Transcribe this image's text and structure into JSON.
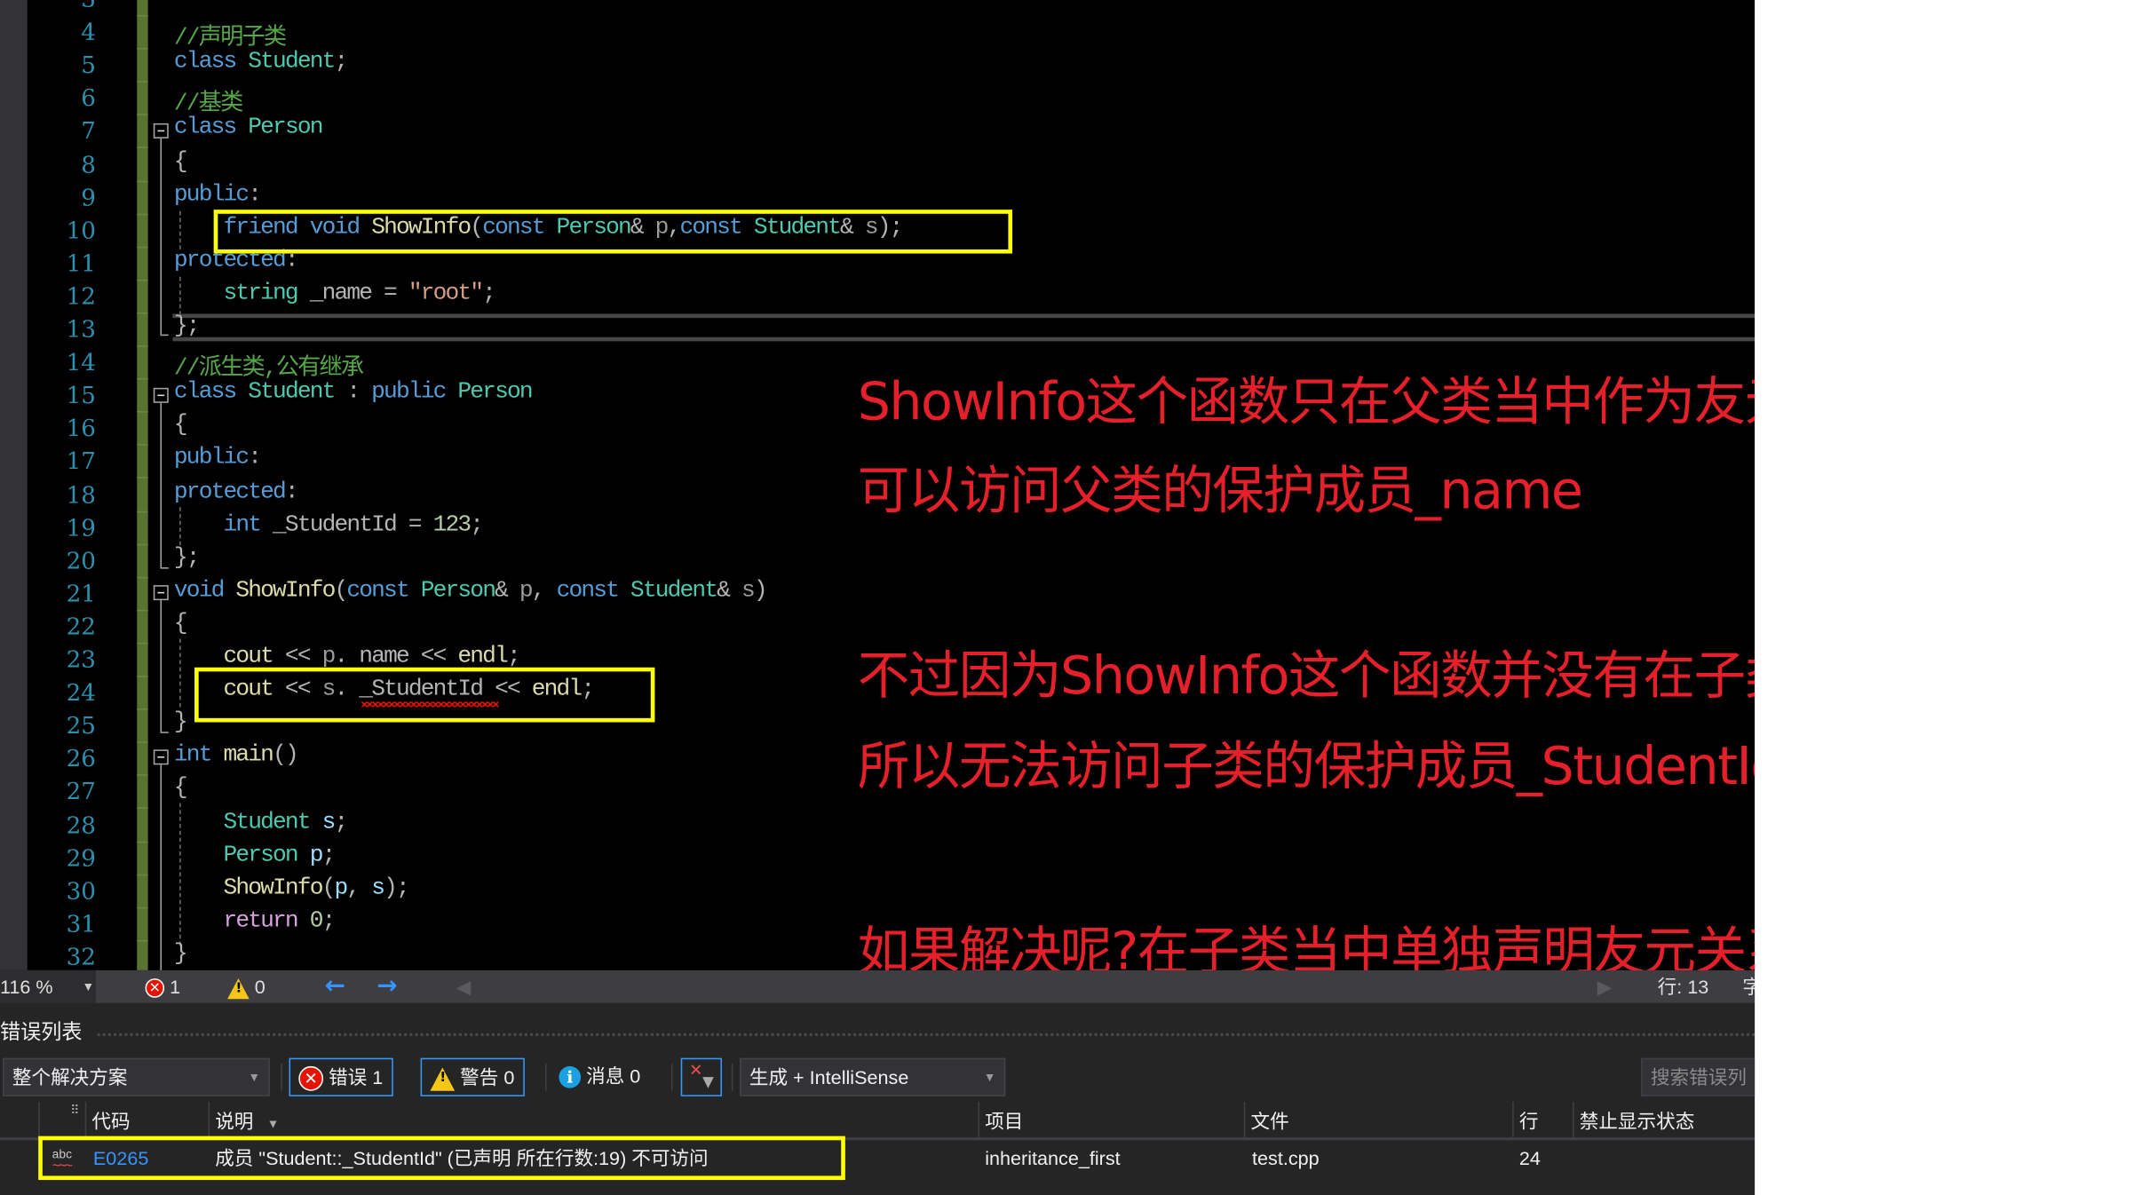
{
  "editor": {
    "lines": [
      {
        "n": "3",
        "tokens": []
      },
      {
        "n": "4",
        "tokens": [
          [
            "cm",
            "//声明子类"
          ]
        ]
      },
      {
        "n": "5",
        "tokens": [
          [
            "kw",
            "class"
          ],
          [
            "pu",
            " "
          ],
          [
            "ty",
            "Student"
          ],
          [
            "pu",
            ";"
          ]
        ]
      },
      {
        "n": "6",
        "tokens": [
          [
            "cm",
            "//基类"
          ]
        ]
      },
      {
        "n": "7",
        "tokens": [
          [
            "kw",
            "class"
          ],
          [
            "pu",
            " "
          ],
          [
            "ty",
            "Person"
          ]
        ]
      },
      {
        "n": "8",
        "tokens": [
          [
            "pu",
            "{"
          ]
        ]
      },
      {
        "n": "9",
        "tokens": [
          [
            "kw",
            "public"
          ],
          [
            "pu",
            ":"
          ]
        ]
      },
      {
        "n": "10",
        "tokens": [
          [
            "pu",
            "    "
          ],
          [
            "kw",
            "friend"
          ],
          [
            "pu",
            " "
          ],
          [
            "kw",
            "void"
          ],
          [
            "pu",
            " "
          ],
          [
            "fn",
            "ShowInfo"
          ],
          [
            "pu",
            "("
          ],
          [
            "kw",
            "const"
          ],
          [
            "pu",
            " "
          ],
          [
            "ty",
            "Person"
          ],
          [
            "pu",
            "& "
          ],
          [
            "pm",
            "p"
          ],
          [
            "pu",
            ","
          ],
          [
            "kw",
            "const"
          ],
          [
            "pu",
            " "
          ],
          [
            "ty",
            "Student"
          ],
          [
            "pu",
            "& "
          ],
          [
            "pm",
            "s"
          ],
          [
            "pu",
            ");"
          ]
        ]
      },
      {
        "n": "11",
        "tokens": [
          [
            "kw",
            "protected"
          ],
          [
            "pu",
            ":"
          ]
        ]
      },
      {
        "n": "12",
        "tokens": [
          [
            "pu",
            "    "
          ],
          [
            "ty",
            "string"
          ],
          [
            "pu",
            " "
          ],
          [
            "pu",
            "_name = "
          ],
          [
            "st",
            "\"root\""
          ],
          [
            "pu",
            ";"
          ]
        ]
      },
      {
        "n": "13",
        "tokens": [
          [
            "pu",
            "};"
          ]
        ]
      },
      {
        "n": "14",
        "tokens": [
          [
            "cm",
            "//派生类,公有继承"
          ]
        ]
      },
      {
        "n": "15",
        "tokens": [
          [
            "kw",
            "class"
          ],
          [
            "pu",
            " "
          ],
          [
            "ty",
            "Student"
          ],
          [
            "pu",
            " : "
          ],
          [
            "kw",
            "public"
          ],
          [
            "pu",
            " "
          ],
          [
            "ty",
            "Person"
          ]
        ]
      },
      {
        "n": "16",
        "tokens": [
          [
            "pu",
            "{"
          ]
        ]
      },
      {
        "n": "17",
        "tokens": [
          [
            "kw",
            "public"
          ],
          [
            "pu",
            ":"
          ]
        ]
      },
      {
        "n": "18",
        "tokens": [
          [
            "kw",
            "protected"
          ],
          [
            "pu",
            ":"
          ]
        ]
      },
      {
        "n": "19",
        "tokens": [
          [
            "pu",
            "    "
          ],
          [
            "kw",
            "int"
          ],
          [
            "pu",
            " _StudentId = "
          ],
          [
            "nu",
            "123"
          ],
          [
            "pu",
            ";"
          ]
        ]
      },
      {
        "n": "20",
        "tokens": [
          [
            "pu",
            "};"
          ]
        ]
      },
      {
        "n": "21",
        "tokens": [
          [
            "kw",
            "void"
          ],
          [
            "pu",
            " "
          ],
          [
            "fn",
            "ShowInfo"
          ],
          [
            "pu",
            "("
          ],
          [
            "kw",
            "const"
          ],
          [
            "pu",
            " "
          ],
          [
            "ty",
            "Person"
          ],
          [
            "pu",
            "& "
          ],
          [
            "pm",
            "p"
          ],
          [
            "pu",
            ", "
          ],
          [
            "kw",
            "const"
          ],
          [
            "pu",
            " "
          ],
          [
            "ty",
            "Student"
          ],
          [
            "pu",
            "& "
          ],
          [
            "pm",
            "s"
          ],
          [
            "pu",
            ")"
          ]
        ]
      },
      {
        "n": "22",
        "tokens": [
          [
            "pu",
            "{"
          ]
        ]
      },
      {
        "n": "23",
        "tokens": [
          [
            "pu",
            "    "
          ],
          [
            "fn",
            "cout"
          ],
          [
            "pu",
            " << "
          ],
          [
            "pm",
            "p"
          ],
          [
            "pu",
            ". "
          ],
          [
            "pu",
            "name << "
          ],
          [
            "fn",
            "endl"
          ],
          [
            "pu",
            ";"
          ]
        ]
      },
      {
        "n": "24",
        "tokens": [
          [
            "pu",
            "    "
          ],
          [
            "fn",
            "cout"
          ],
          [
            "pu",
            " << "
          ],
          [
            "pm",
            "s"
          ],
          [
            "pu",
            ". "
          ],
          [
            "pu",
            "_StudentId"
          ],
          [
            "pu",
            " << "
          ],
          [
            "fn",
            "endl"
          ],
          [
            "pu",
            ";"
          ]
        ]
      },
      {
        "n": "25",
        "tokens": [
          [
            "pu",
            "}"
          ]
        ]
      },
      {
        "n": "26",
        "tokens": [
          [
            "kw",
            "int"
          ],
          [
            "pu",
            " "
          ],
          [
            "fn",
            "main"
          ],
          [
            "pu",
            "()"
          ]
        ]
      },
      {
        "n": "27",
        "tokens": [
          [
            "pu",
            "{"
          ]
        ]
      },
      {
        "n": "28",
        "tokens": [
          [
            "pu",
            "    "
          ],
          [
            "ty",
            "Student"
          ],
          [
            "pu",
            " "
          ],
          [
            "lv",
            "s"
          ],
          [
            "pu",
            ";"
          ]
        ]
      },
      {
        "n": "29",
        "tokens": [
          [
            "pu",
            "    "
          ],
          [
            "ty",
            "Person"
          ],
          [
            "pu",
            " "
          ],
          [
            "lv",
            "p"
          ],
          [
            "pu",
            ";"
          ]
        ]
      },
      {
        "n": "30",
        "tokens": [
          [
            "pu",
            "    "
          ],
          [
            "fn",
            "ShowInfo"
          ],
          [
            "pu",
            "("
          ],
          [
            "lv",
            "p"
          ],
          [
            "pu",
            ", "
          ],
          [
            "lv",
            "s"
          ],
          [
            "pu",
            ");"
          ]
        ]
      },
      {
        "n": "31",
        "tokens": [
          [
            "pu",
            "    "
          ],
          [
            "rt",
            "return"
          ],
          [
            "pu",
            " "
          ],
          [
            "nu",
            "0"
          ],
          [
            "pu",
            ";"
          ]
        ]
      },
      {
        "n": "32",
        "tokens": [
          [
            "pu",
            "}"
          ]
        ]
      }
    ],
    "current_line": "13",
    "error_line": "24",
    "error_token": "_StudentId"
  },
  "annotations": [
    "ShowInfo这个函数只在父类当中作为友元",
    "可以访问父类的保护成员_name",
    "不过因为ShowInfo这个函数并没有在子类中作为友元",
    "所以无法访问子类的保护成员_StudentId",
    "如果解决呢?在子类当中单独声明友元关系即可"
  ],
  "statusbar": {
    "zoom": "116 %",
    "errors": "1",
    "warnings": "0",
    "back_icon": "←",
    "forward_icon": "→",
    "line_label": "行: 13",
    "col_label_partial": "字"
  },
  "error_list": {
    "title": "错误列表",
    "scope": "整个解决方案",
    "filter_errors": "错误 1",
    "filter_warnings": "警告 0",
    "filter_messages": "消息 0",
    "source": "生成 + IntelliSense",
    "search_placeholder": "搜索错误列",
    "columns": [
      "代码",
      "说明",
      "项目",
      "文件",
      "行",
      "禁止显示状态"
    ],
    "rows": [
      {
        "code": "E0265",
        "description": "成员 \"Student::_StudentId\" (已声明 所在行数:19) 不可访问",
        "project": "inheritance_first",
        "file": "test.cpp",
        "line": "24",
        "suppression": ""
      }
    ]
  },
  "colors": {
    "annotation": "#e5202a",
    "highlight_box": "#ffff00",
    "accent": "#3399ff"
  }
}
